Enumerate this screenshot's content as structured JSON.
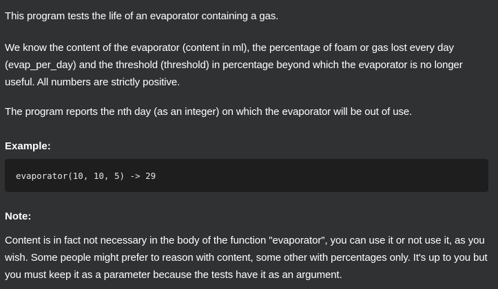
{
  "description": {
    "intro": "This program tests the life of an evaporator containing a gas.",
    "details": "We know the content of the evaporator (content in ml), the percentage of foam or gas lost every day (evap_per_day) and the threshold (threshold) in percentage beyond which the evaporator is no longer useful. All numbers are strictly positive.",
    "report": "The program reports the nth day (as an integer) on which the evaporator will be out of use."
  },
  "example": {
    "heading": "Example:",
    "code": "evaporator(10, 10, 5) -> 29"
  },
  "note": {
    "heading": "Note:",
    "text": "Content is in fact not necessary in the body of the function \"evaporator\", you can use it or not use it, as you wish. Some people might prefer to reason with content, some other with percentages only. It's up to you but you must keep it as a parameter because the tests have it as an argument."
  }
}
